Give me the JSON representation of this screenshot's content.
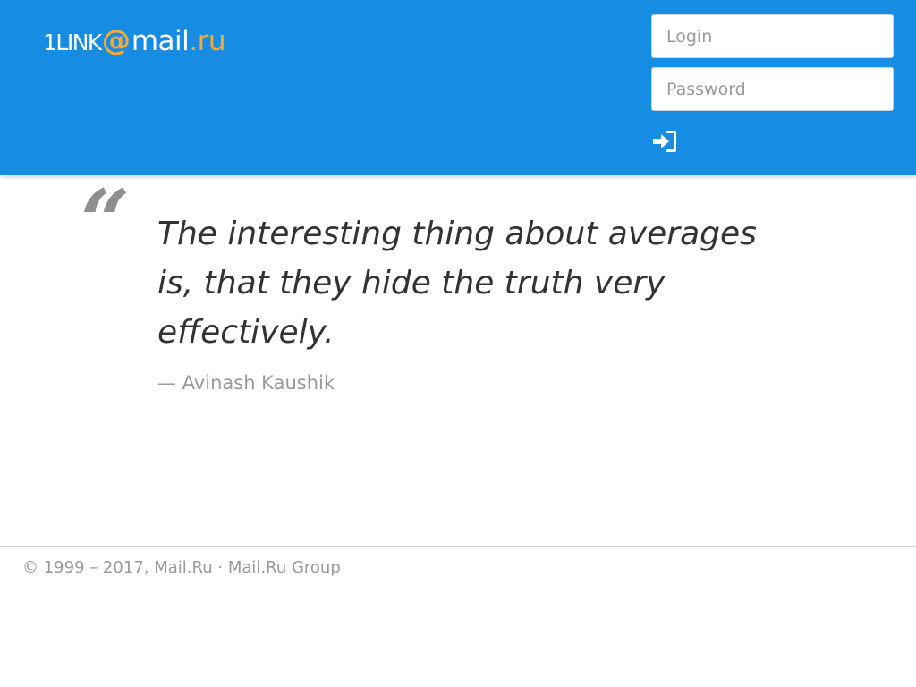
{
  "header": {
    "logo": {
      "prefix": "1LINK",
      "at": "@",
      "mail": "mail",
      "ru": ".ru"
    },
    "login": {
      "login_placeholder": "Login",
      "password_placeholder": "Password",
      "submit_icon": "sign-in-icon"
    }
  },
  "quote": {
    "mark": "“",
    "text": "The interesting thing about averages is, that they hide the truth very effectively.",
    "author": "— Avinash Kaushik"
  },
  "footer": {
    "copyright": "© 1999 – 2017,",
    "link_mailru": "Mail.Ru",
    "separator": "·",
    "link_group": "Mail.Ru Group"
  },
  "colors": {
    "header_bg": "#168de2",
    "logo_accent": "#ffa930",
    "quote_text": "#333333",
    "muted_text": "#999999"
  }
}
